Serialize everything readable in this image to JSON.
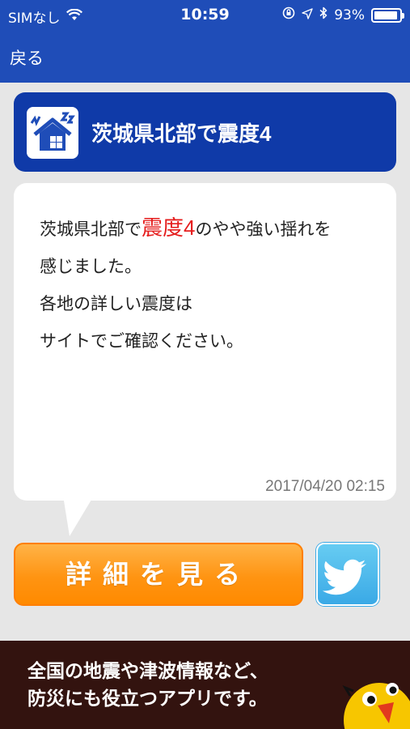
{
  "status_bar": {
    "carrier": "SIMなし",
    "time": "10:59",
    "battery_percent": "93%",
    "battery_level": 0.93
  },
  "nav": {
    "back_label": "戻る"
  },
  "alert": {
    "title": "茨城県北部で震度4",
    "message_prefix": "茨城県北部で",
    "message_highlight": "震度4",
    "message_suffix": "のやや強い揺れを",
    "message_line2": "感じました。",
    "message_line3": "各地の詳しい震度は",
    "message_line4": "サイトでご確認ください。",
    "timestamp": "2017/04/20 02:15"
  },
  "actions": {
    "details_label": "詳細を見る",
    "share_icon": "twitter-bird-icon"
  },
  "banner": {
    "line1": "全国の地震や津波情報など、",
    "line2": "防災にも役立つアプリです。"
  },
  "colors": {
    "header_blue": "#1f4db8",
    "title_card_blue": "#0f3aa8",
    "highlight_red": "#e51e1e",
    "button_orange": "#ff9412",
    "twitter_blue": "#3aa9e6",
    "banner_bg": "#33130f"
  }
}
